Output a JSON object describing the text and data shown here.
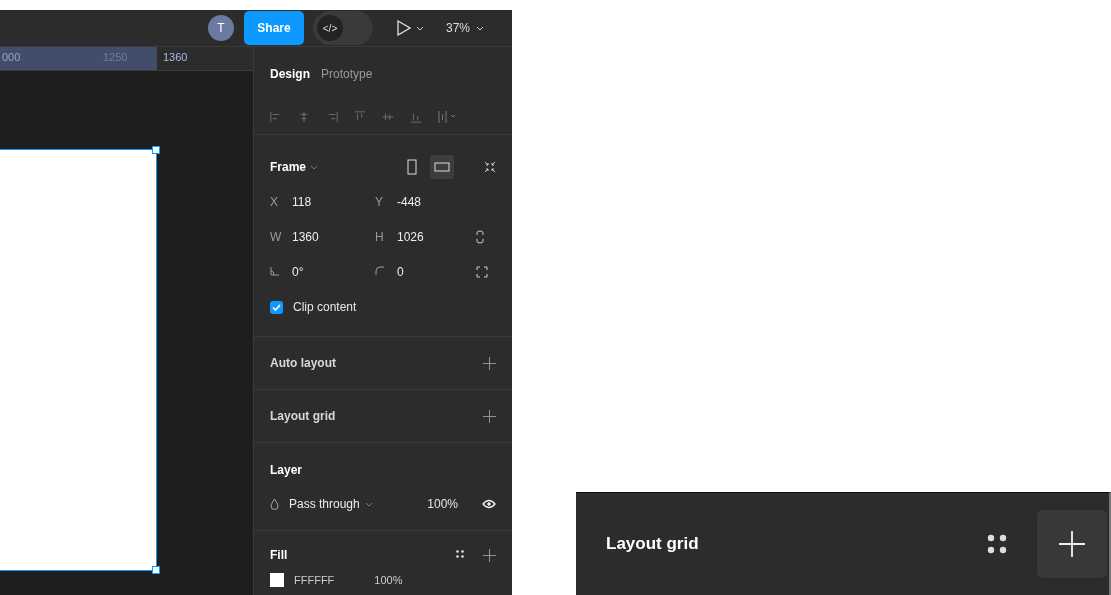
{
  "toolbar": {
    "avatar": "T",
    "share": "Share",
    "code_toggle": "</>",
    "zoom": "37%"
  },
  "ruler": {
    "labels": [
      "000",
      "1250",
      "1360"
    ]
  },
  "panel": {
    "tabs": [
      {
        "label": "Design",
        "selected": true
      },
      {
        "label": "Prototype",
        "selected": false
      }
    ],
    "frame": {
      "title": "Frame",
      "orientations": [
        {
          "kind": "portrait",
          "selected": false
        },
        {
          "kind": "landscape",
          "selected": true
        }
      ],
      "fields": [
        {
          "kind": "letter",
          "label": "X",
          "value": "118"
        },
        {
          "kind": "letter",
          "label": "Y",
          "value": "-448"
        },
        {
          "kind": "letter",
          "label": "W",
          "value": "1360"
        },
        {
          "kind": "letter",
          "label": "H",
          "value": "1026"
        },
        {
          "kind": "rotation",
          "value": "0°"
        },
        {
          "kind": "radius",
          "value": "0"
        }
      ],
      "clip_content": {
        "label": "Clip content",
        "checked": true
      }
    },
    "sections": [
      {
        "title": "Auto layout"
      },
      {
        "title": "Layout grid"
      }
    ],
    "layer": {
      "title": "Layer",
      "blend": "Pass through",
      "opacity": "100%"
    },
    "fill": {
      "title": "Fill",
      "hex": "FFFFFF",
      "opacity": "100%"
    }
  },
  "zoom_inset": {
    "title": "Layout grid"
  }
}
